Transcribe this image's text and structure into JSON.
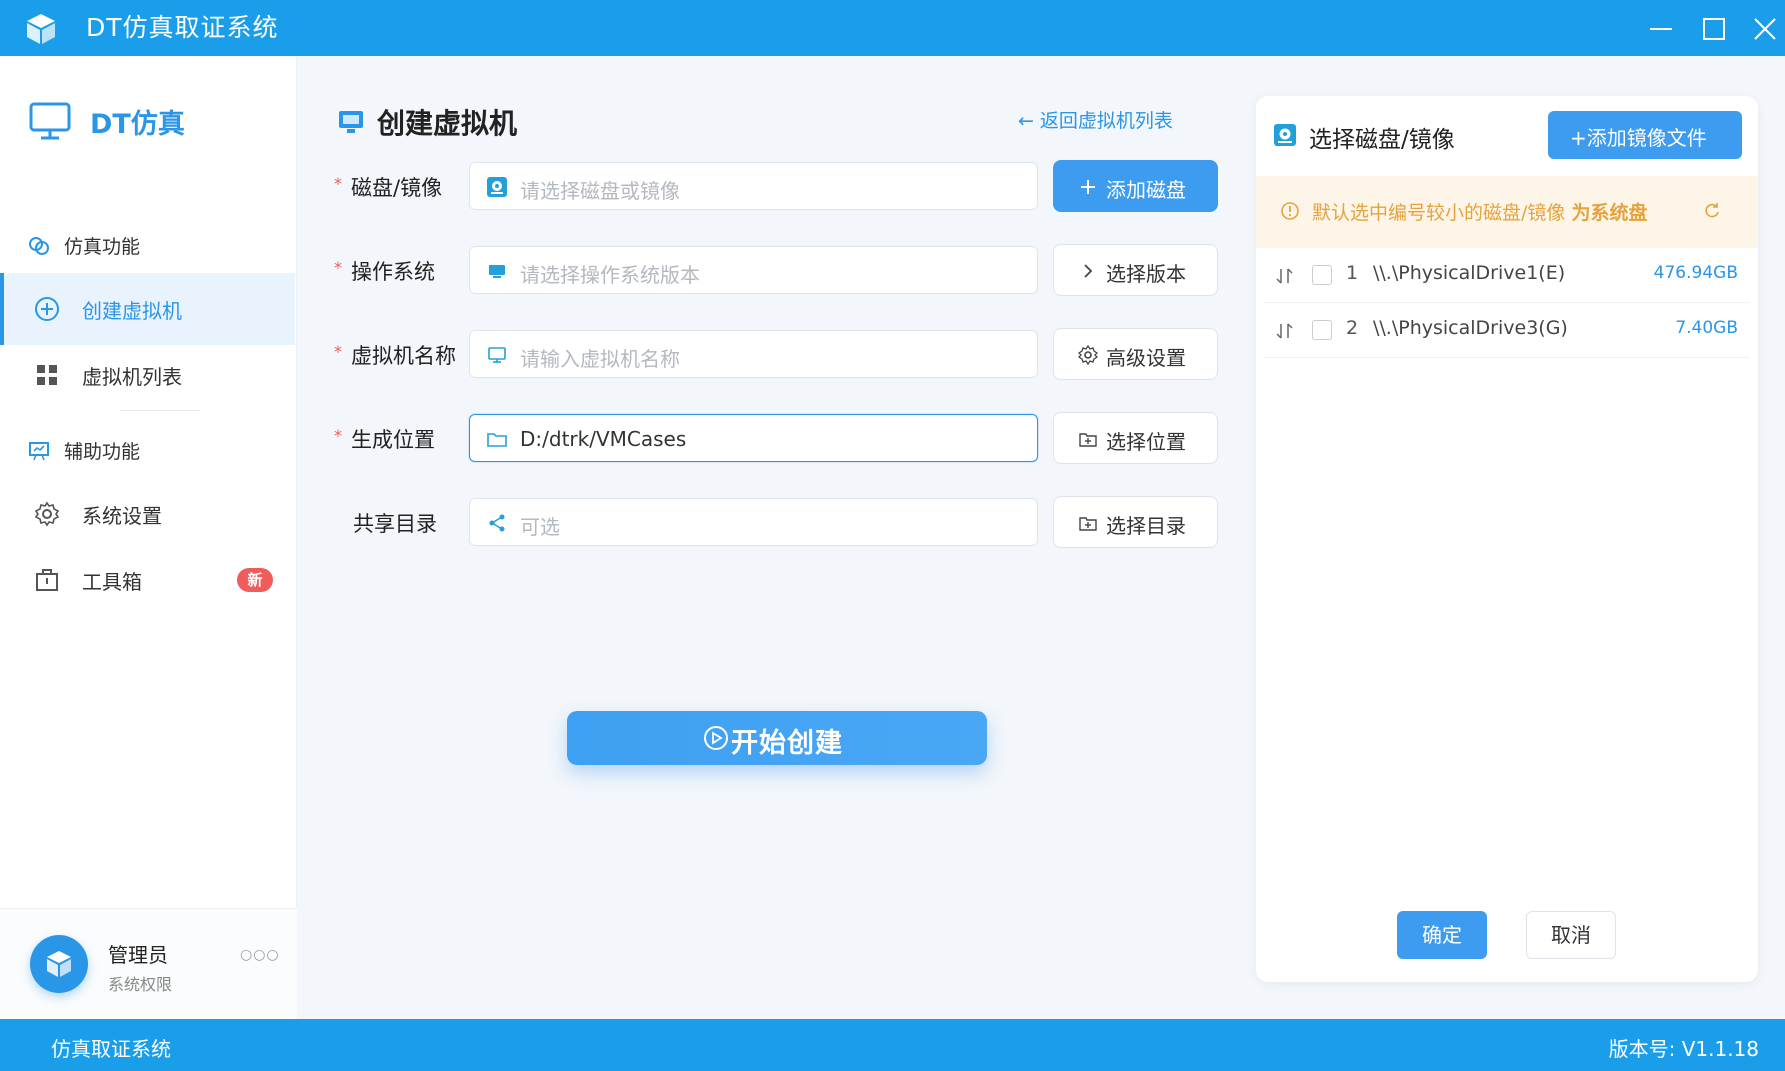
{
  "app": {
    "title": "DT仿真取证系统",
    "accent_color": "#1a9ee9",
    "primary_color": "#3d9cf0"
  },
  "window_controls": [
    "minimize-icon",
    "maximize-icon",
    "close-icon"
  ],
  "sidebar": {
    "brand": "DT仿真",
    "items": [
      {
        "label": "仿真功能",
        "icon": "link-icon",
        "type": "group"
      },
      {
        "label": "创建虚拟机",
        "icon": "plus-circle-icon",
        "type": "sub",
        "active": true
      },
      {
        "label": "虚拟机列表",
        "icon": "grid-icon",
        "type": "sub"
      },
      {
        "label": "辅助功能",
        "icon": "presentation-icon",
        "type": "group"
      },
      {
        "label": "系统设置",
        "icon": "gear-icon",
        "type": "sub"
      },
      {
        "label": "工具箱",
        "icon": "toolbox-icon",
        "type": "sub",
        "badge": "新"
      }
    ],
    "user": {
      "name": "管理员",
      "role": "系统权限",
      "more": "○○○"
    }
  },
  "main": {
    "title": "创建虚拟机",
    "back_link": "返回虚拟机列表",
    "form": {
      "disk": {
        "label": "磁盘/镜像",
        "required": true,
        "placeholder": "请选择磁盘或镜像",
        "button": "添加磁盘"
      },
      "os": {
        "label": "操作系统",
        "required": true,
        "placeholder": "请选择操作系统版本",
        "button": "选择版本"
      },
      "vm_name": {
        "label": "虚拟机名称",
        "required": true,
        "placeholder": "请输入虚拟机名称",
        "button": "高级设置"
      },
      "location": {
        "label": "生成位置",
        "required": true,
        "value": "D:/dtrk/VMCases",
        "button": "选择位置"
      },
      "share": {
        "label": "共享目录",
        "required": false,
        "placeholder": "可选",
        "button": "选择目录"
      }
    },
    "start_button": "开始创建"
  },
  "panel": {
    "title": "选择磁盘/镜像",
    "add_button": "+添加镜像文件",
    "notice_prefix": "默认选中编号较小的磁盘/镜像 ",
    "notice_bold": "为系统盘",
    "notice_color": "#e6a23c",
    "disks": [
      {
        "index": "1",
        "name": "\\\\.\\PhysicalDrive1(E)",
        "size": "476.94GB"
      },
      {
        "index": "2",
        "name": "\\\\.\\PhysicalDrive3(G)",
        "size": "7.40GB"
      }
    ],
    "ok": "确定",
    "cancel": "取消"
  },
  "statusbar": {
    "left": "仿真取证系统",
    "right": "版本号: V1.1.18"
  }
}
